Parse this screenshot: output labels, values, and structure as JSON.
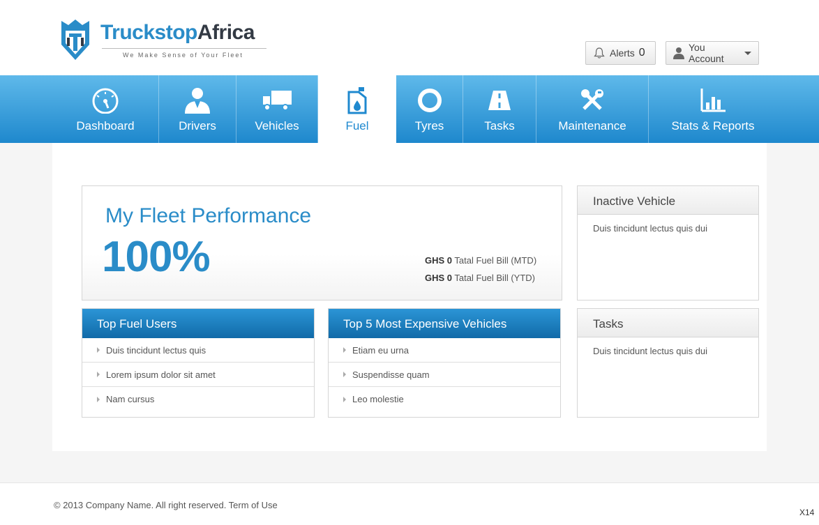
{
  "brand": {
    "name_part1": "Truckstop",
    "name_part2": "Africa",
    "tagline": "We Make Sense of Your Fleet",
    "primary_color": "#2a8cc8",
    "dark_color": "#333a44"
  },
  "header": {
    "alerts_label": "Alerts",
    "alerts_count": "0",
    "alerts_icon": "bell-icon",
    "account_label": "You Account",
    "account_icon": "user-icon"
  },
  "nav": {
    "items": [
      {
        "label": "Dashboard",
        "icon": "speedometer-icon",
        "active": false
      },
      {
        "label": "Drivers",
        "icon": "driver-icon",
        "active": false
      },
      {
        "label": "Vehicles",
        "icon": "truck-icon",
        "active": false
      },
      {
        "label": "Fuel",
        "icon": "fuel-can-icon",
        "active": true
      },
      {
        "label": "Tyres",
        "icon": "tyre-icon",
        "active": false
      },
      {
        "label": "Tasks",
        "icon": "road-icon",
        "active": false
      },
      {
        "label": "Maintenance",
        "icon": "tools-icon",
        "active": false
      },
      {
        "label": "Stats & Reports",
        "icon": "bar-chart-icon",
        "active": false
      }
    ]
  },
  "performance": {
    "title": "My Fleet Performance",
    "value": "100%",
    "mtd_amount": "GHS 0",
    "mtd_label": "Tatal Fuel Bill (MTD)",
    "ytd_amount": "GHS 0",
    "ytd_label": "Tatal Fuel Bill (YTD)"
  },
  "inactive_vehicle": {
    "title": "Inactive Vehicle",
    "text": "Duis tincidunt lectus quis dui"
  },
  "tasks_panel": {
    "title": "Tasks",
    "text": "Duis tincidunt lectus quis dui"
  },
  "top_fuel_users": {
    "title": "Top Fuel Users",
    "items": [
      "Duis tincidunt lectus quis",
      "Lorem ipsum dolor sit amet",
      "Nam cursus"
    ]
  },
  "top_expensive": {
    "title": "Top 5 Most Expensive Vehicles",
    "items": [
      "Etiam eu urna",
      "Suspendisse quam",
      "Leo molestie"
    ]
  },
  "footer": {
    "copyright": "© 2013 Company Name.  All right reserved.  Term of Use",
    "page_code": "X14"
  }
}
